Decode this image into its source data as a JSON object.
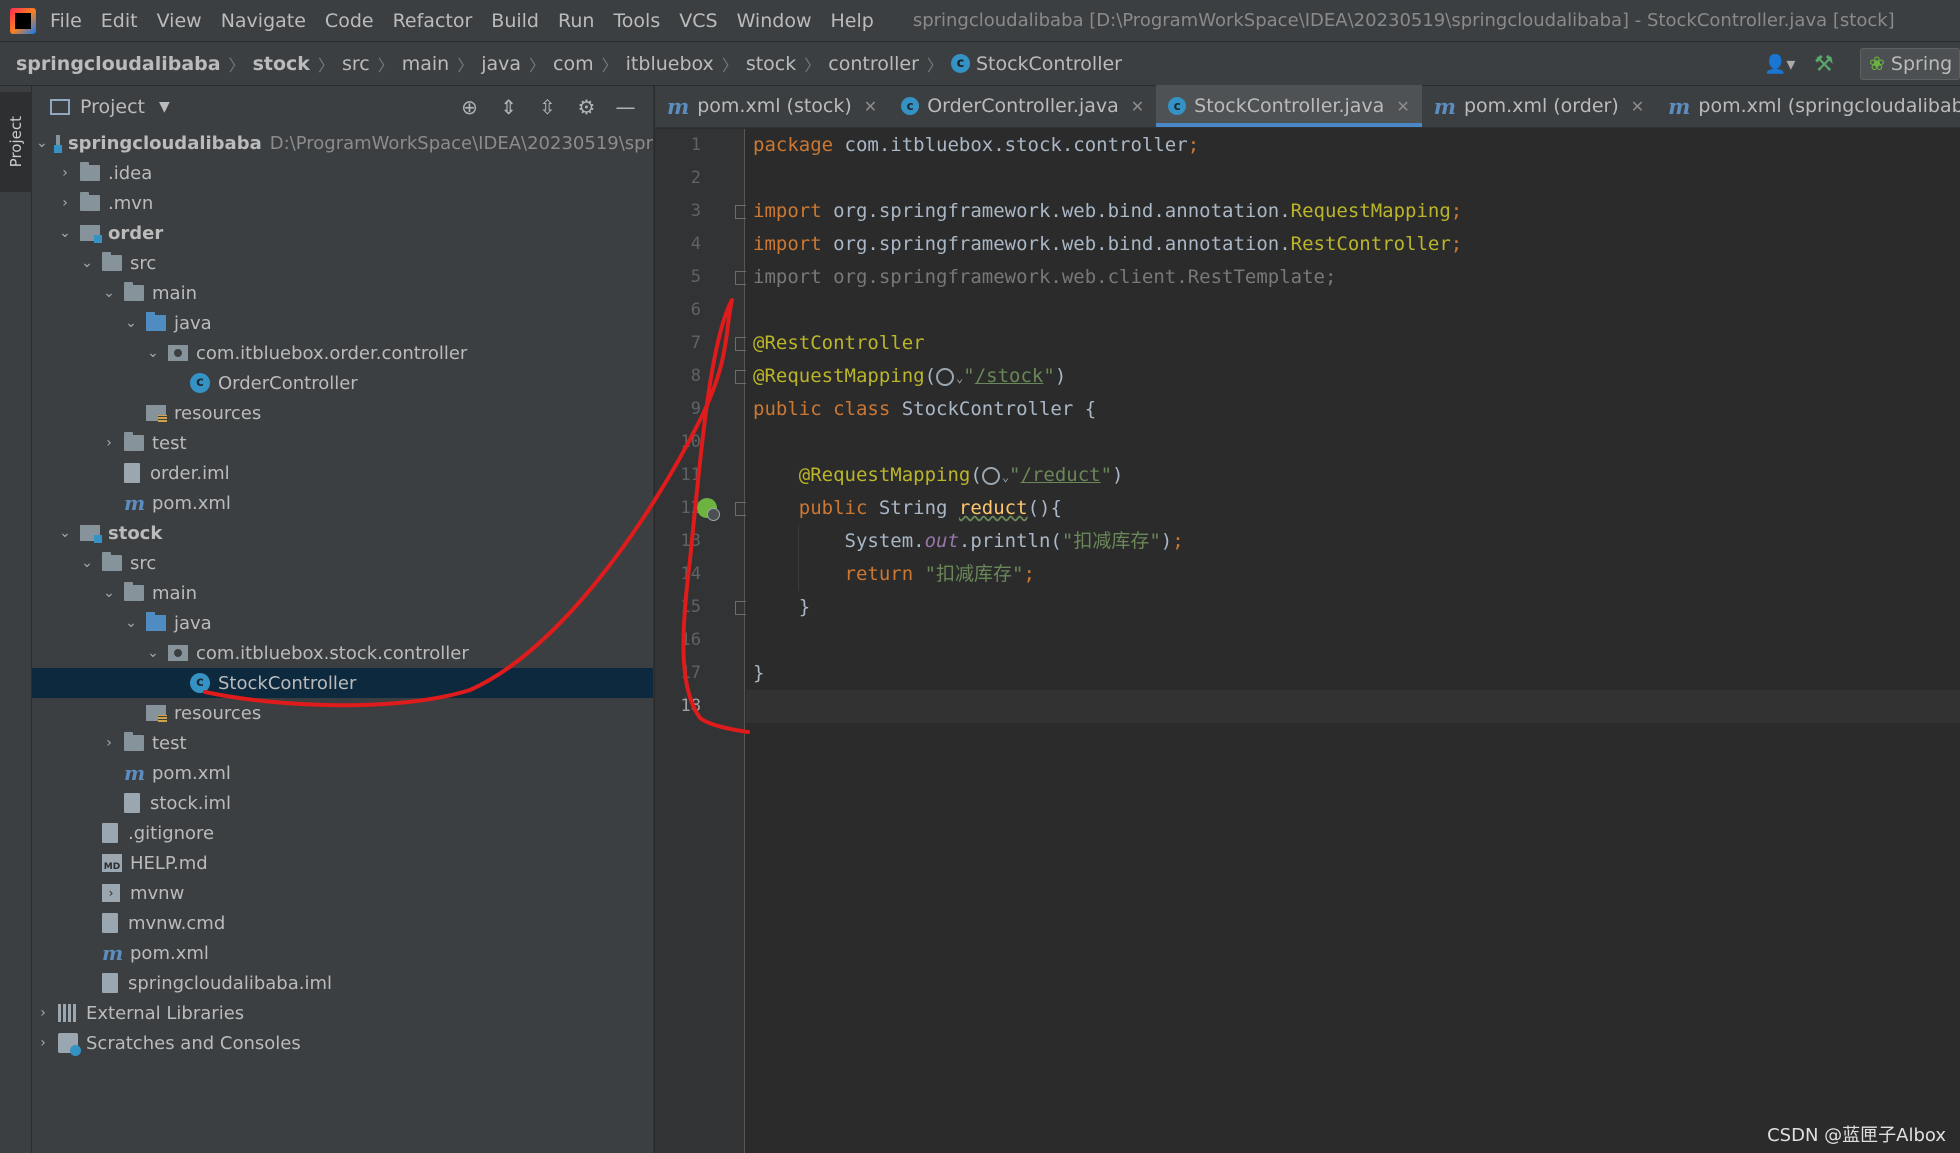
{
  "menu": [
    "File",
    "Edit",
    "View",
    "Navigate",
    "Code",
    "Refactor",
    "Build",
    "Run",
    "Tools",
    "VCS",
    "Window",
    "Help"
  ],
  "window_title": "springcloudalibaba [D:\\ProgramWorkSpace\\IDEA\\20230519\\springcloudalibaba] - StockController.java [stock]",
  "breadcrumb": [
    "springcloudalibaba",
    "stock",
    "src",
    "main",
    "java",
    "com",
    "itbluebox",
    "stock",
    "controller",
    "StockController"
  ],
  "run_config": "Spring",
  "project_panel": {
    "title": "Project",
    "strip_label": "Project"
  },
  "tree": {
    "root": "springcloudalibaba",
    "root_path": "D:\\ProgramWorkSpace\\IDEA\\20230519\\spr",
    "idea": ".idea",
    "mvn": ".mvn",
    "order": "order",
    "order_src": "src",
    "order_main": "main",
    "order_java": "java",
    "order_pkg": "com.itbluebox.order.controller",
    "order_controller": "OrderController",
    "order_resources": "resources",
    "order_test": "test",
    "order_iml": "order.iml",
    "order_pom": "pom.xml",
    "stock": "stock",
    "stock_src": "src",
    "stock_main": "main",
    "stock_java": "java",
    "stock_pkg": "com.itbluebox.stock.controller",
    "stock_controller": "StockController",
    "stock_resources": "resources",
    "stock_test": "test",
    "stock_pom": "pom.xml",
    "stock_iml": "stock.iml",
    "gitignore": ".gitignore",
    "help": "HELP.md",
    "mvnw": "mvnw",
    "mvnw_cmd": "mvnw.cmd",
    "root_pom": "pom.xml",
    "root_iml": "springcloudalibaba.iml",
    "ext_libs": "External Libraries",
    "scratches": "Scratches and Consoles"
  },
  "tabs": [
    "pom.xml (stock)",
    "OrderController.java",
    "StockController.java",
    "pom.xml (order)",
    "pom.xml (springcloudalibaba)"
  ],
  "line_numbers": [
    "1",
    "2",
    "3",
    "4",
    "5",
    "6",
    "7",
    "8",
    "9",
    "10",
    "11",
    "12",
    "13",
    "14",
    "15",
    "16",
    "17",
    "18"
  ],
  "code": {
    "l1_kw": "package",
    "l1_rest": " com.itbluebox.stock.controller",
    "semi": ";",
    "import_kw": "import",
    "l3_pkg": " org.springframework.web.bind.annotation.",
    "l3_cls": "RequestMapping",
    "l4_pkg": " org.springframework.web.bind.annotation.",
    "l4_cls": "RestController",
    "l5_rest": " org.springframework.web.client.RestTemplate;",
    "l7": "@RestController",
    "l8_ann": "@RequestMapping",
    "l8_path": "/stock",
    "l9_kw": "public class",
    "l9_rest": " StockController {",
    "l11_ann": "@RequestMapping",
    "l11_path": "/reduct",
    "l12_kw": "public",
    "l12_type": " String ",
    "l12_fn": "reduct",
    "l12_rest": "(){",
    "l13_sys": "System.",
    "l13_out": "out",
    "l13_println": ".println(",
    "l13_str": "\"扣减库存\"",
    "l13_end": ")",
    "l14_kw": "return",
    "l14_str": " \"扣减库存\"",
    "brace_close": "}"
  },
  "watermark": "CSDN @蓝匣子Albox",
  "colors": {
    "selection": "#0d293e",
    "accent_tab": "#4a88c7",
    "annotation_stroke": "#e01b1b"
  }
}
